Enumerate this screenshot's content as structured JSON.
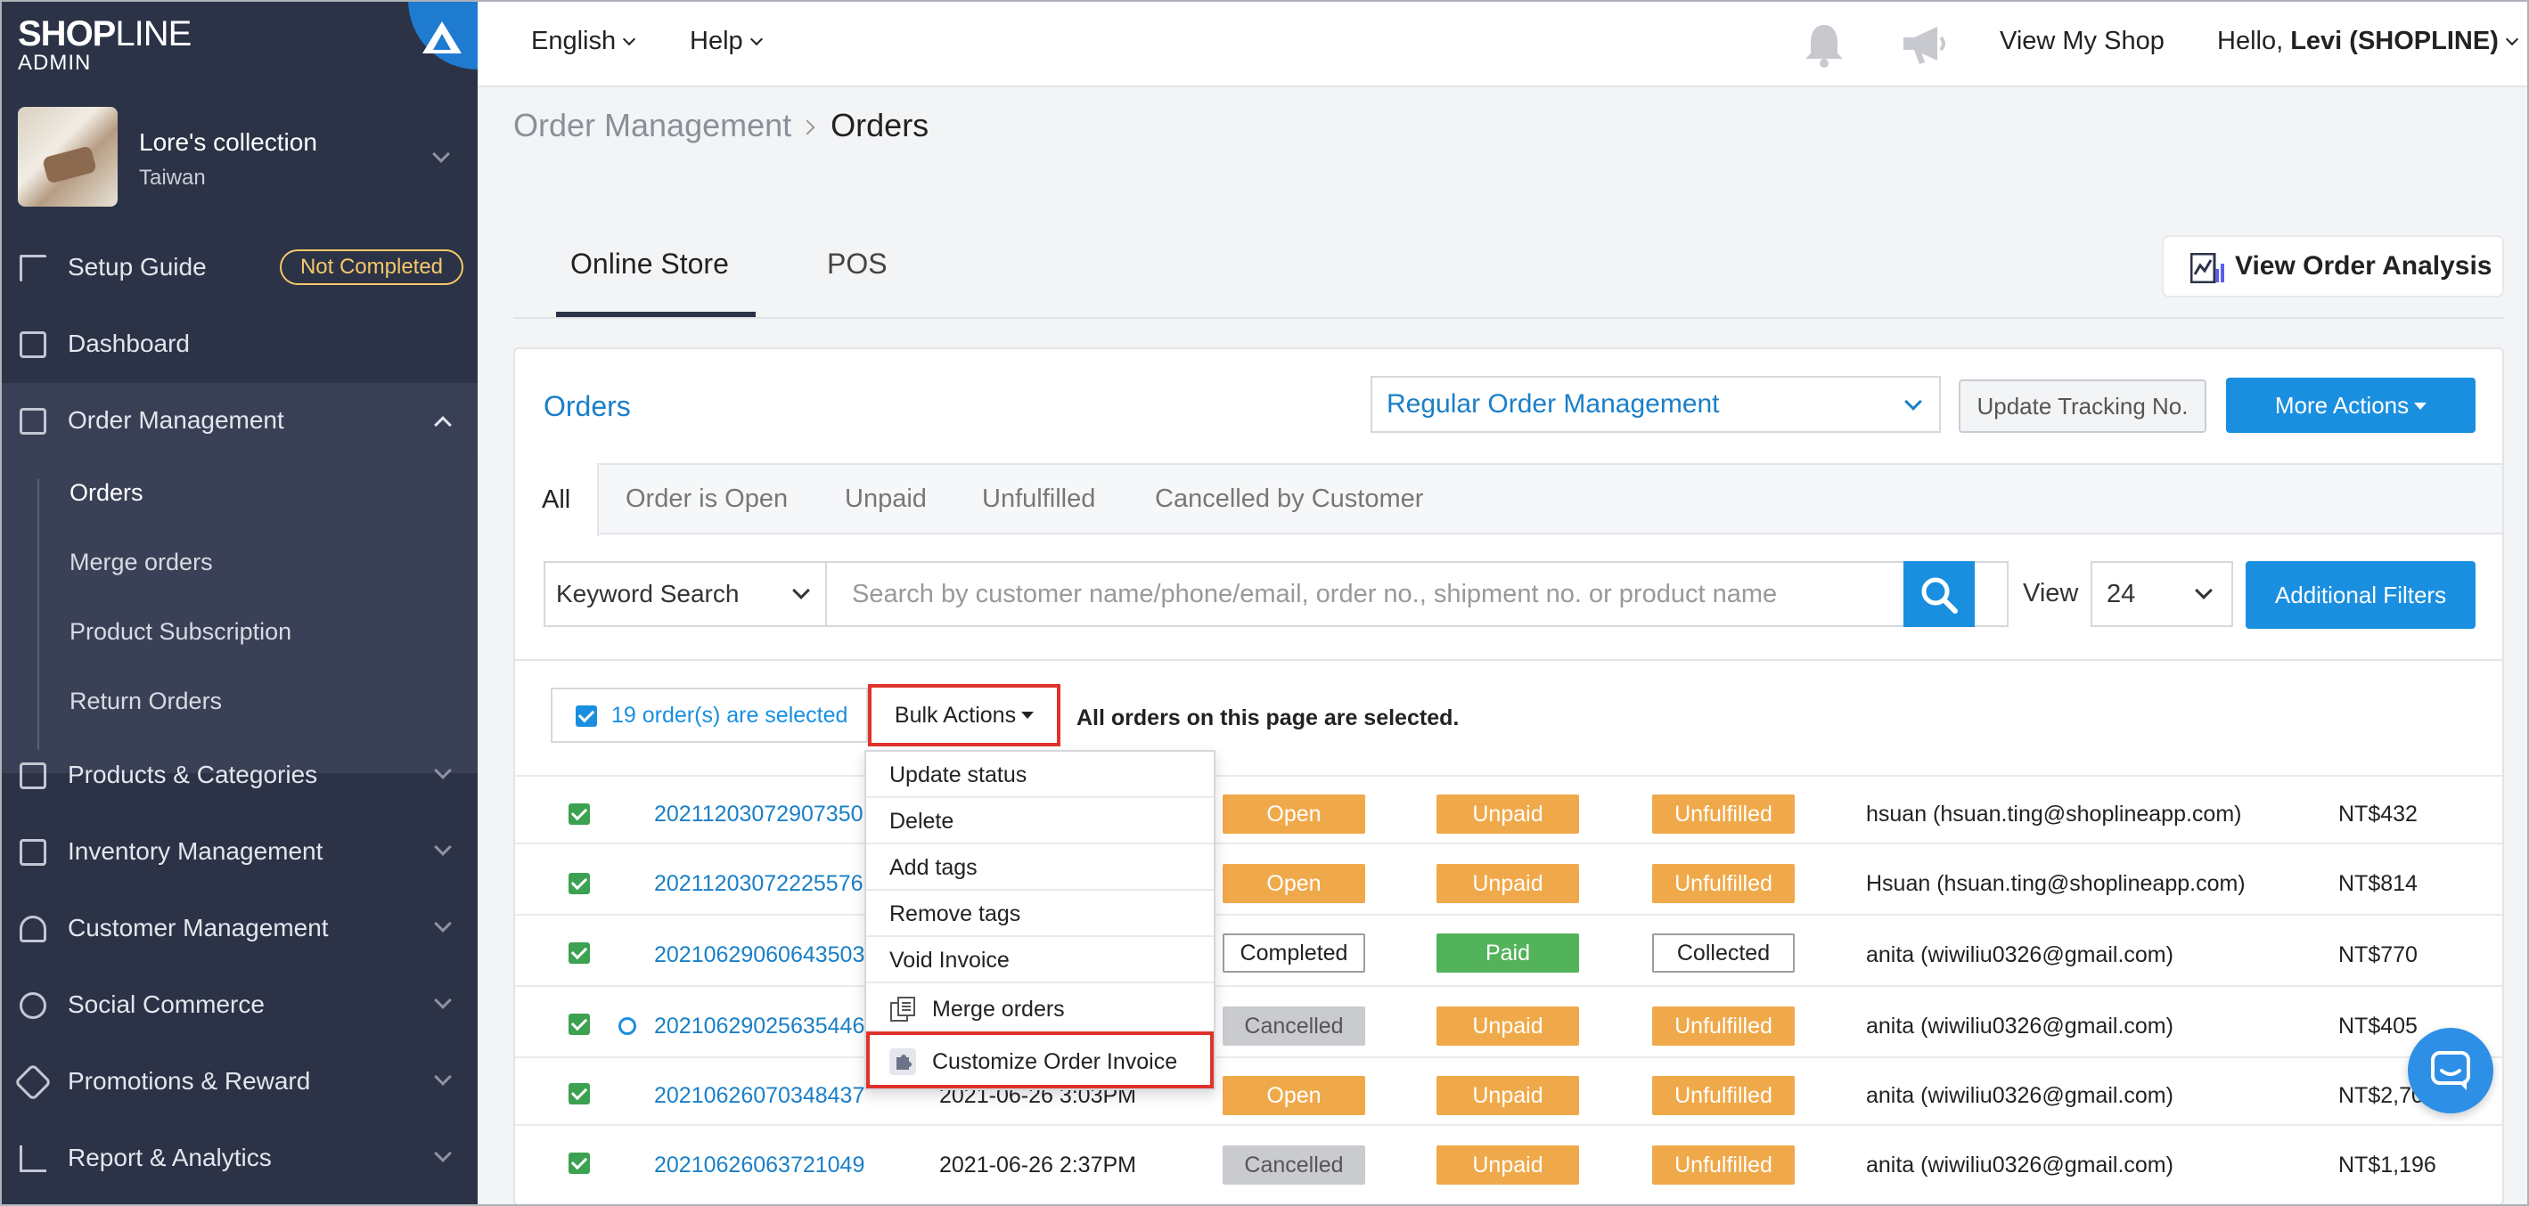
{
  "brand": {
    "logo_main": "SHOP",
    "logo_thin": "LINE",
    "logo_sub": "ADMIN"
  },
  "store": {
    "name": "Lore's collection",
    "region": "Taiwan"
  },
  "sidebar": {
    "setup_guide": "Setup Guide",
    "setup_badge": "Not Completed",
    "dashboard": "Dashboard",
    "order_management": "Order Management",
    "sub": [
      "Orders",
      "Merge orders",
      "Product Subscription",
      "Return Orders"
    ],
    "items": [
      "Products & Categories",
      "Inventory Management",
      "Customer Management",
      "Social Commerce",
      "Promotions & Reward",
      "Report & Analytics"
    ]
  },
  "topbar": {
    "language": "English",
    "help": "Help",
    "view_shop": "View My Shop",
    "hello": "Hello, ",
    "user": "Levi (SHOPLINE)"
  },
  "breadcrumb": {
    "parent": "Order Management",
    "current": "Orders"
  },
  "tabs": [
    "Online Store",
    "POS"
  ],
  "view_order_analysis": "View Order Analysis",
  "card": {
    "title": "Orders",
    "mode_select": "Regular Order Management",
    "update_tracking": "Update Tracking No.",
    "more_actions": "More Actions"
  },
  "status_tabs": [
    "All",
    "Order is Open",
    "Unpaid",
    "Unfulfilled",
    "Cancelled by Customer"
  ],
  "search": {
    "type": "Keyword Search",
    "placeholder": "Search by customer name/phone/email, order no., shipment no. or product name",
    "view_label": "View",
    "view_value": "24",
    "additional_filters": "Additional Filters"
  },
  "selection": {
    "count_text": "19 order(s) are selected",
    "bulk_actions": "Bulk Actions",
    "all_selected": "All orders on this page are selected."
  },
  "bulk_menu": [
    "Update status",
    "Delete",
    "Add tags",
    "Remove tags",
    "Void Invoice",
    "Merge orders",
    "Customize Order Invoice"
  ],
  "orders": [
    {
      "no": "20211203072907350",
      "date": "",
      "order_status": "Open",
      "payment": "Unpaid",
      "delivery": "Unfulfilled",
      "customer": "hsuan (hsuan.ting@shoplineapp.com)",
      "amount": "NT$432"
    },
    {
      "no": "20211203072225576",
      "date": "",
      "order_status": "Open",
      "payment": "Unpaid",
      "delivery": "Unfulfilled",
      "customer": "Hsuan (hsuan.ting@shoplineapp.com)",
      "amount": "NT$814"
    },
    {
      "no": "20210629060643503",
      "date": "",
      "order_status": "Completed",
      "payment": "Paid",
      "delivery": "Collected",
      "customer": "anita (wiwiliu0326@gmail.com)",
      "amount": "NT$770"
    },
    {
      "no": "20210629025635446",
      "date": "",
      "order_status": "Cancelled",
      "payment": "Unpaid",
      "delivery": "Unfulfilled",
      "customer": "anita (wiwiliu0326@gmail.com)",
      "amount": "NT$405"
    },
    {
      "no": "20210626070348437",
      "date": "2021-06-26 3:03PM",
      "order_status": "Open",
      "payment": "Unpaid",
      "delivery": "Unfulfilled",
      "customer": "anita (wiwiliu0326@gmail.com)",
      "amount": "NT$2,70"
    },
    {
      "no": "20210626063721049",
      "date": "2021-06-26 2:37PM",
      "order_status": "Cancelled",
      "payment": "Unpaid",
      "delivery": "Unfulfilled",
      "customer": "anita (wiwiliu0326@gmail.com)",
      "amount": "NT$1,196"
    }
  ],
  "colors": {
    "sidebar": "#2c3347",
    "accent": "#1a8fe0",
    "link": "#1a7fc8",
    "highlight": "#e0322b",
    "orange": "#f0a94a",
    "green": "#53b35a"
  }
}
